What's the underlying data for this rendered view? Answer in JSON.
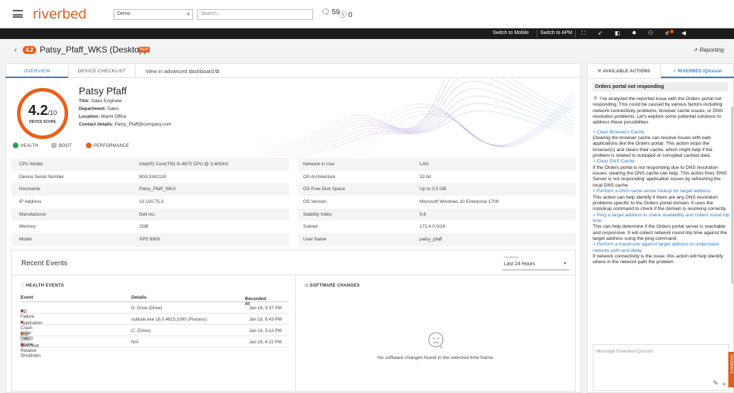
{
  "brand": {
    "logo": "riverbed",
    "accent": "#e35b19",
    "link": "#2f7bbf"
  },
  "topbar": {
    "group_select": "Demo",
    "search_placeholder": "Search...",
    "chat_count": "59",
    "alert_count": "0"
  },
  "blackbar": {
    "switch_mobile": "Switch to Mobile",
    "switch_apm": "Switch to APM",
    "icons": [
      "expand-icon",
      "rocket-icon",
      "document-icon",
      "gear-icon",
      "user-icon",
      "notification-icon",
      "megaphone-icon"
    ]
  },
  "header": {
    "score_badge": "4.2",
    "device_title": "Patsy_Pfaff_WKS (Desktop)",
    "new_badge": "NEW",
    "reporting_label": "Reporting"
  },
  "tabs": [
    {
      "label": "OVERVIEW",
      "active": true
    },
    {
      "label": "DEVICE CHECKLIST",
      "active": false
    }
  ],
  "advanced_link": "View in advanced dashboard",
  "device": {
    "score": "4.2",
    "score_suffix": "/10",
    "score_label": "DEVICE SCORE",
    "person_name": "Patsy Pfaff",
    "title_label": "Title:",
    "title": "Sales Engineer",
    "department_label": "Department:",
    "department": "Sales",
    "location_label": "Location:",
    "location": "Miami Office",
    "contact_label": "Contact details:",
    "contact": "Patsy_Pfaff@company.com"
  },
  "status": [
    {
      "label": "HEALTH",
      "color": "#2e9e4f",
      "icon": "check-icon"
    },
    {
      "label": "BOOT",
      "color": "#bbbbbb",
      "icon": ""
    },
    {
      "label": "PERFORMANCE",
      "color": "#e8611c",
      "icon": "exclamation-icon"
    }
  ],
  "specs_left": [
    {
      "k": "CPU Model",
      "v": "Intel(R) Core(TM) i5-4670 CPU @ 3.40GHz"
    },
    {
      "k": "Device Serial Number",
      "v": "MXL5361130"
    },
    {
      "k": "Hostname",
      "v": "Patsy_Pfaff_WKS"
    },
    {
      "k": "IP Address",
      "v": "10.100.75.3"
    },
    {
      "k": "Manufacturer",
      "v": "Dell Inc."
    },
    {
      "k": "Memory",
      "v": "2GB"
    },
    {
      "k": "Model",
      "v": "XPS 8900"
    }
  ],
  "specs_right": [
    {
      "k": "Network in Use",
      "v": "LAN"
    },
    {
      "k": "OS Architecture",
      "v": "32-bit"
    },
    {
      "k": "OS Free Disk Space",
      "v": "Up to 0.5 GB"
    },
    {
      "k": "OS Version",
      "v": "Microsoft Windows 10 Enterprise 1709"
    },
    {
      "k": "Stability Index",
      "v": "9.8"
    },
    {
      "k": "Subnet",
      "v": "172.4.0.0/16"
    },
    {
      "k": "User Name",
      "v": "patsy_pfaff"
    }
  ],
  "events": {
    "title": "Recent Events",
    "timeframe_label": "Timeframe",
    "timeframe": "Last 24 Hours",
    "health_title": "HEALTH EVENTS",
    "columns": {
      "event": "Event",
      "details": "Details",
      "recorded": "Recorded At"
    },
    "rows": [
      {
        "event": "HD Failure",
        "details": "D: Drive (Drive)",
        "recorded": "Jan 16, 9:37 PM",
        "color": "#e03a3a"
      },
      {
        "event": "Application Crash (After Hang)",
        "details": "outlook.exe 16.0.4615.1000 (Process)",
        "recorded": "Jan 16, 6:43 PM",
        "color": "#e8611c"
      },
      {
        "event": "Low Disk Space",
        "details": "C: (Drive)",
        "recorded": "Jan 16, 5:12 PM",
        "color": "#e8611c"
      },
      {
        "event": "Overheat Related Shutdown",
        "details": "N/A",
        "recorded": "Jan 16, 4:22 PM",
        "color": "#e03a3a"
      }
    ],
    "software_title": "SOFTWARE CHANGES",
    "no_changes": "No software changes found in the selected time frame."
  },
  "side": {
    "tab_actions": "AVAILABLE ACTIONS",
    "tab_iq": "RIVERBED IQAssist",
    "chat_title": "Orders portal not responding",
    "intro": "I've analyzed the reported issue with the Orders portal not responding. This could be caused by various factors including network connectivity problems, browser cache issues, or DNS resolution problems. Let's explore some potential solutions to address these possibilities.",
    "items": [
      {
        "link": "> Clear Browsers Cache",
        "text": "Clearing the browser cache can resolve issues with web applications like the Orders portal. This action stops the browser(s) and clears their cache, which might help if the problem is related to outdated or corrupted cached data."
      },
      {
        "link": "> Clear DNS Cache",
        "text": "If the Orders portal is not responding due to DNS resolution issues, clearing the DNS cache can help. This action fixes 'DNS Server is not responding' application issues by refreshing the local DNS cache."
      },
      {
        "link": "> Perform a DNS name server lookup for target address",
        "text": "This action can help identify if there are any DNS resolution problems specific to the Orders portal domain. It uses the nslookup command to check if the domain is resolving correctly."
      },
      {
        "link": "> Ping a target address to check availability and collect round trip time",
        "text": "This can help determine if the Orders portal server is reachable and responsive. It will collect network round trip time against the target address using the ping command."
      },
      {
        "link": "> Perform a traceroute against target address to understand network path and delay",
        "text": "If network connectivity is the issue, this action will help identify where in the network path the problem"
      }
    ],
    "message_placeholder": "Message Riverbed IQAssist",
    "feedback": "FEEDBACK"
  }
}
